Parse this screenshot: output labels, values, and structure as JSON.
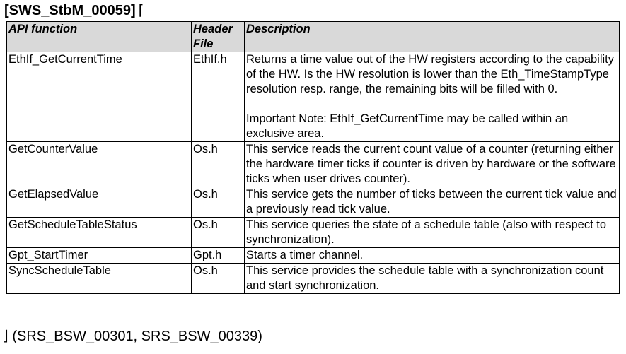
{
  "requirement": {
    "id": "[SWS_StbM_00059]",
    "open_bracket": "⌈"
  },
  "table": {
    "headers": {
      "api_function": "API function",
      "header_file": "Header File",
      "description": "Description"
    },
    "rows": [
      {
        "api": "EthIf_GetCurrentTime",
        "header": "EthIf.h",
        "description": [
          "Returns a time value out of the HW registers according to the capability of the HW. Is the HW resolution is lower than the Eth_TimeStampType resolution resp. range, the remaining bits will be filled with 0.",
          "Important Note: EthIf_GetCurrentTime may be called within an exclusive area."
        ]
      },
      {
        "api": "GetCounterValue",
        "header": "Os.h",
        "description": [
          "This service reads the current count value of a counter (returning either the hardware timer ticks if counter is driven by hardware or the software ticks when user drives counter)."
        ]
      },
      {
        "api": "GetElapsedValue",
        "header": "Os.h",
        "description": [
          "This service gets the number of ticks between the current tick value and a previously read tick value."
        ]
      },
      {
        "api": "GetScheduleTableStatus",
        "header": "Os.h",
        "description": [
          "This service queries the state of a schedule table (also with respect to synchronization)."
        ]
      },
      {
        "api": "Gpt_StartTimer",
        "header": "Gpt.h",
        "description": [
          "Starts a timer channel."
        ]
      },
      {
        "api": "SyncScheduleTable",
        "header": "Os.h",
        "description": [
          "This service provides the schedule table with a synchronization count and start synchronization."
        ]
      }
    ]
  },
  "traceability": "⌋ (SRS_BSW_00301, SRS_BSW_00339)"
}
